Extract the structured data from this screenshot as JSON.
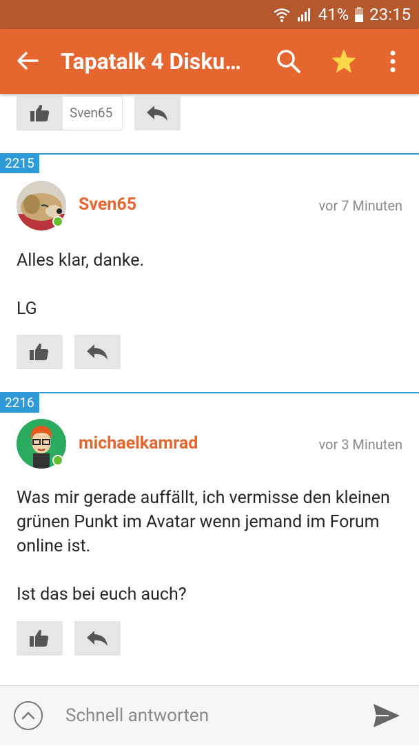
{
  "status_bar": {
    "battery": "41%",
    "time": "23:15"
  },
  "app_bar": {
    "title": "Tapatalk 4 Disku…"
  },
  "prev_post": {
    "liked_by": "Sven65"
  },
  "posts": [
    {
      "number": "2215",
      "username": "Sven65",
      "time": "vor 7 Minuten",
      "text": "Alles klar, danke.\n\nLG"
    },
    {
      "number": "2216",
      "username": "michaelkamrad",
      "time": "vor 3 Minuten",
      "text": "Was mir gerade auffällt, ich vermisse den kleinen grünen Punkt im Avatar wenn jemand im Forum online ist.\n\nIst das bei euch auch?"
    }
  ],
  "reply": {
    "placeholder": "Schnell antworten"
  },
  "colors": {
    "brand": "#e5662f",
    "status_bar": "#b4582d",
    "divider": "#2f9ad8",
    "online": "#63c12f"
  }
}
